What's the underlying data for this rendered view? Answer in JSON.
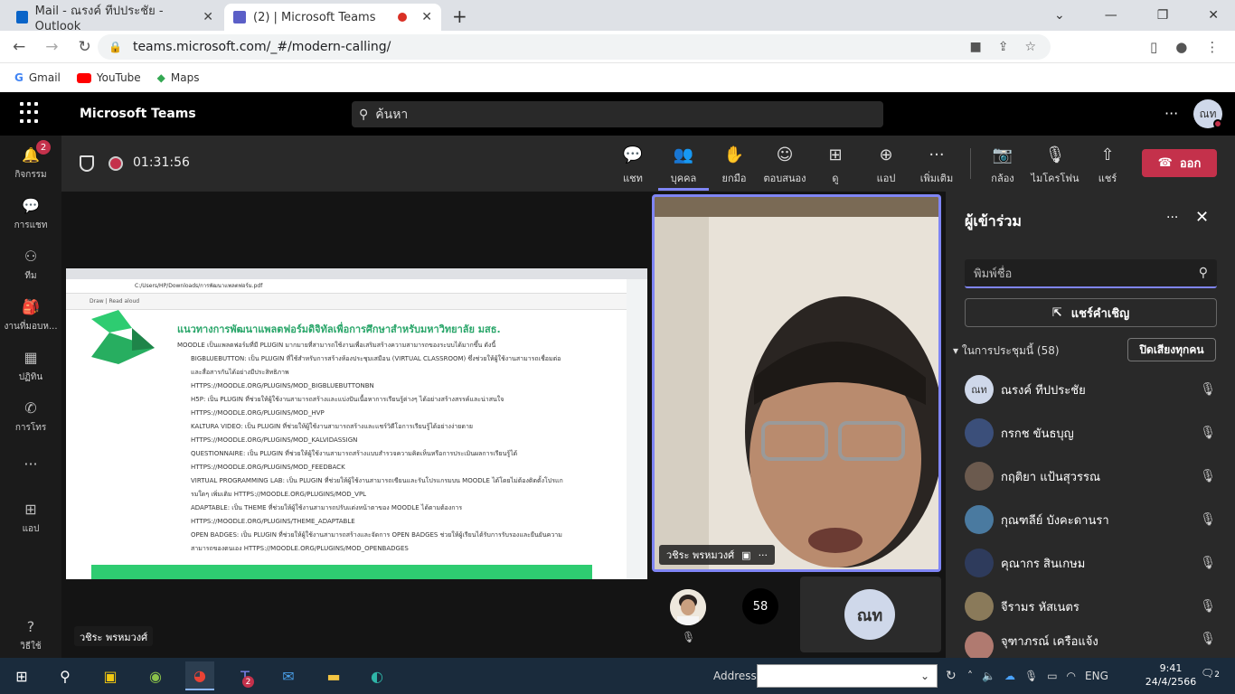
{
  "browser": {
    "tabs": [
      {
        "title": "Mail - ณรงค์ ทีปประชัย - Outlook",
        "active": false
      },
      {
        "title": "(2) | Microsoft Teams",
        "active": true
      }
    ],
    "new_tab": "+",
    "url": "teams.microsoft.com/_#/modern-calling/",
    "bookmarks": [
      "Gmail",
      "YouTube",
      "Maps"
    ]
  },
  "teams": {
    "brand": "Microsoft Teams",
    "search_placeholder": "ค้นหา",
    "more": "···",
    "avatar_initials": "ณท"
  },
  "rail": {
    "badge": "2",
    "items": [
      "กิจกรรม",
      "การแชท",
      "ทีม",
      "งานที่มอบห...",
      "ปฏิทิน",
      "การโทร",
      "···",
      "แอป",
      "วิธีใช้"
    ]
  },
  "meeting": {
    "timer": "01:31:56",
    "toolbar": [
      "แชท",
      "บุคคล",
      "ยกมือ",
      "ตอบสนอง",
      "ดู",
      "แอป",
      "เพิ่มเติม",
      "กล้อง",
      "ไมโครโฟน",
      "แชร์"
    ],
    "leave": "ออก"
  },
  "stage": {
    "speaker_name": "วชิระ พรหมวงศ์",
    "presenter_label": "วชิระ พรหมวงศ์",
    "overflow_count": "58",
    "self_initials": "ณท",
    "shared_doc": {
      "address": "C:/Users/HP/Downloads/การพัฒนาแพลตฟอร์ม.pdf",
      "pdf_toolbar": "Draw   |   Read aloud",
      "title": "แนวทางการพัฒนาแพลตฟอร์มดิจิทัลเพื่อการศึกษาสำหรับมหาวิทยาลัย มสธ.",
      "intro": "MOODLE เป็นแพลตฟอร์มที่มี PLUGIN มากมายที่สามารถใช้งานเพื่อเสริมสร้างความสามารถของระบบได้มากขึ้น ดังนี้",
      "bullets": [
        "BIGBLUEBUTTON: เป็น PLUGIN ที่ใช้สำหรับการสร้างห้องประชุมเสมือน (VIRTUAL CLASSROOM) ซึ่งช่วยให้ผู้ใช้งานสามารถเชื่อมต่อและสื่อสารกันได้อย่างมีประสิทธิภาพ",
        "HTTPS://MOODLE.ORG/PLUGINS/MOD_BIGBLUEBUTTONBN",
        "H5P: เป็น PLUGIN ที่ช่วยให้ผู้ใช้งานสามารถสร้างและแบ่งปันเนื้อหาการเรียนรู้ต่างๆ ได้อย่างสร้างสรรค์และน่าสนใจ",
        "HTTPS://MOODLE.ORG/PLUGINS/MOD_HVP",
        "KALTURA VIDEO: เป็น PLUGIN ที่ช่วยให้ผู้ใช้งานสามารถสร้างและแชร์วิดีโอการเรียนรู้ได้อย่างง่ายดาย",
        "HTTPS://MOODLE.ORG/PLUGINS/MOD_KALVIDASSIGN",
        "QUESTIONNAIRE: เป็น PLUGIN ที่ช่วยให้ผู้ใช้งานสามารถสร้างแบบสำรวจความคิดเห็นหรือการประเมินผลการเรียนรู้ได้ HTTPS://MOODLE.ORG/PLUGINS/MOD_FEEDBACK",
        "VIRTUAL PROGRAMMING LAB: เป็น PLUGIN ที่ช่วยให้ผู้ใช้งานสามารถเขียนและรันโปรแกรมบน MOODLE ได้โดยไม่ต้องติดตั้งโปรแกรมใดๆ เพิ่มเติม HTTPS://MOODLE.ORG/PLUGINS/MOD_VPL",
        "ADAPTABLE: เป็น THEME ที่ช่วยให้ผู้ใช้งานสามารถปรับแต่งหน้าตาของ MOODLE ได้ตามต้องการ",
        "HTTPS://MOODLE.ORG/PLUGINS/THEME_ADAPTABLE",
        "OPEN BADGES: เป็น PLUGIN ที่ช่วยให้ผู้ใช้งานสามารถสร้างและจัดการ OPEN BADGES ช่วยให้ผู้เรียนได้รับการรับรองและยืนยันความสามารถของตนเอง HTTPS://MOODLE.ORG/PLUGINS/MOD_OPENBADGES"
      ]
    }
  },
  "participants": {
    "title": "ผู้เข้าร่วม",
    "search_placeholder": "พิมพ์ชื่อ",
    "invite": "แชร์คำเชิญ",
    "in_meeting": "ในการประชุมนี้ (58)",
    "mute_all": "ปิดเสียงทุกคน",
    "people": [
      {
        "name": "ณรงค์ ทีปประชัย",
        "initials": "ณท",
        "color": "#cfd8ea"
      },
      {
        "name": "กรกช ขันธบุญ",
        "initials": "",
        "color": "#3b4f7a"
      },
      {
        "name": "กฤติยา แป้นสุวรรณ",
        "initials": "",
        "color": "#6b5a4e"
      },
      {
        "name": "กุณฑลีย์ บังคะดานรา",
        "initials": "",
        "color": "#4a7aa0"
      },
      {
        "name": "คุณากร สินเกษม",
        "initials": "",
        "color": "#2e3b5c"
      },
      {
        "name": "จีรามร หัสเนตร",
        "initials": "",
        "color": "#8a7a5a"
      },
      {
        "name": "จุฑาภรณ์ เครือแจ้ง",
        "initials": "",
        "color": "#b07a70"
      }
    ]
  },
  "taskbar": {
    "address_label": "Address",
    "lang": "ENG",
    "time": "9:41",
    "date": "24/4/2566",
    "teams_badge": "2",
    "notif_count": "2"
  }
}
